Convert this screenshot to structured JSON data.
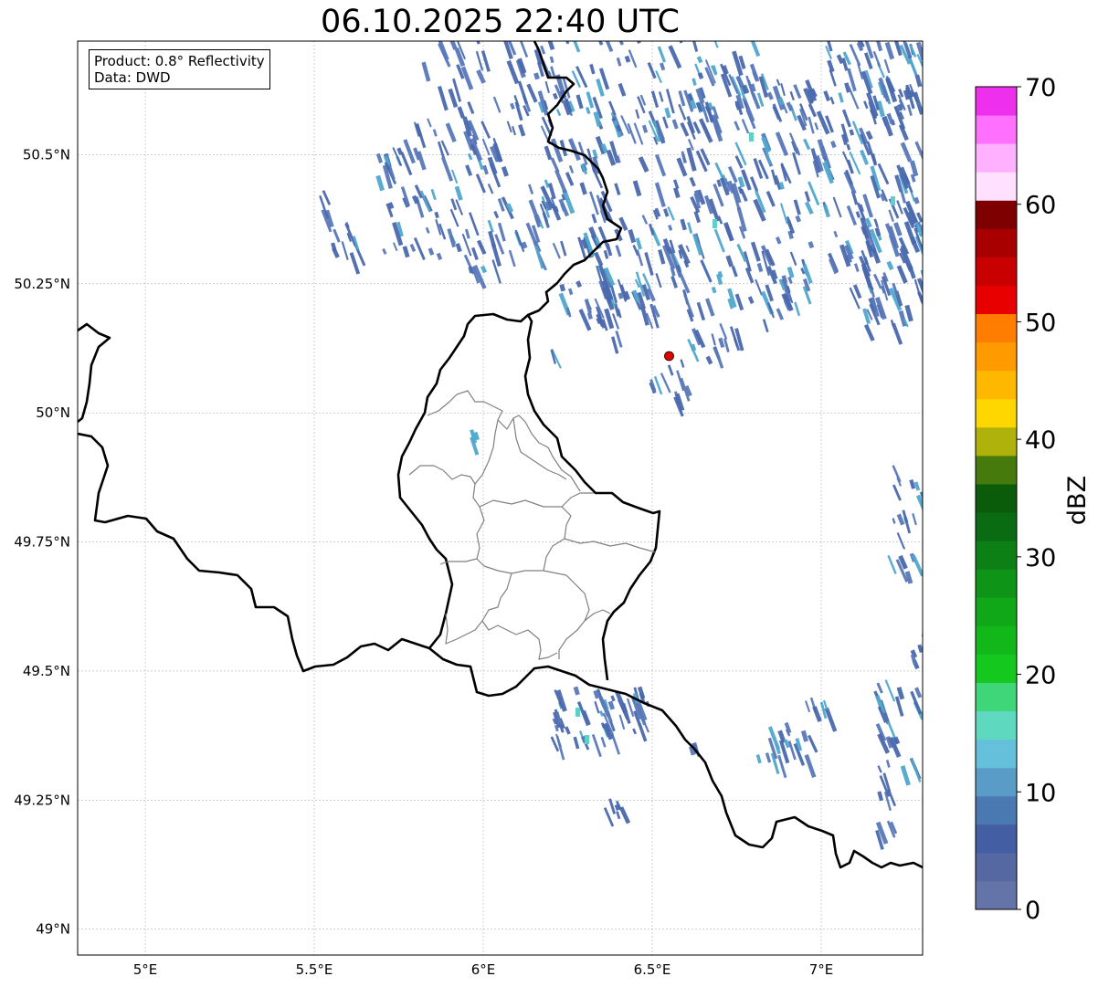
{
  "title": "06.10.2025 22:40 UTC",
  "info": {
    "product": "Product: 0.8° Reflectivity",
    "data": "Data: DWD"
  },
  "map": {
    "lon_range": [
      4.8,
      7.3
    ],
    "lat_range": [
      48.95,
      50.72
    ],
    "lon_ticks": [
      {
        "value": 5.0,
        "label": "5°E"
      },
      {
        "value": 5.5,
        "label": "5.5°E"
      },
      {
        "value": 6.0,
        "label": "6°E"
      },
      {
        "value": 6.5,
        "label": "6.5°E"
      },
      {
        "value": 7.0,
        "label": "7°E"
      }
    ],
    "lat_ticks": [
      {
        "value": 50.5,
        "label": "50.5°N"
      },
      {
        "value": 50.25,
        "label": "50.25°N"
      },
      {
        "value": 50.0,
        "label": "50°N"
      },
      {
        "value": 49.75,
        "label": "49.75°N"
      },
      {
        "value": 49.5,
        "label": "49.5°N"
      },
      {
        "value": 49.25,
        "label": "49.25°N"
      },
      {
        "value": 49.0,
        "label": "49°N"
      }
    ],
    "radar_site": {
      "lon": 6.55,
      "lat": 50.11,
      "color": "#e00000"
    },
    "grid": true
  },
  "colorbar": {
    "label": "dBZ",
    "vmin": 0,
    "vmax": 70,
    "tick_labels": [
      "0",
      "10",
      "20",
      "30",
      "40",
      "50",
      "60",
      "70"
    ],
    "tick_values": [
      0,
      10,
      20,
      30,
      40,
      50,
      60,
      70
    ],
    "colors": [
      "#6574a8",
      "#5568a1",
      "#435ea3",
      "#4a78b0",
      "#5a9cc8",
      "#65c0dc",
      "#5fd8c0",
      "#3fd679",
      "#14c81e",
      "#12b81a",
      "#10a818",
      "#0e9416",
      "#0c8014",
      "#0a6c12",
      "#0a5c0a",
      "#467a0c",
      "#aeb20a",
      "#ffd700",
      "#ffb800",
      "#ff9a00",
      "#ff7d00",
      "#e80000",
      "#c80000",
      "#a80000",
      "#7e0000",
      "#ffe0ff",
      "#ffb0ff",
      "#ff70ff",
      "#ee30ee"
    ]
  },
  "echo_colors": {
    "light": "#4a68ad",
    "medium": "#5878b8",
    "strong": "#4fa8cc",
    "peak": "#5fd0c8"
  }
}
